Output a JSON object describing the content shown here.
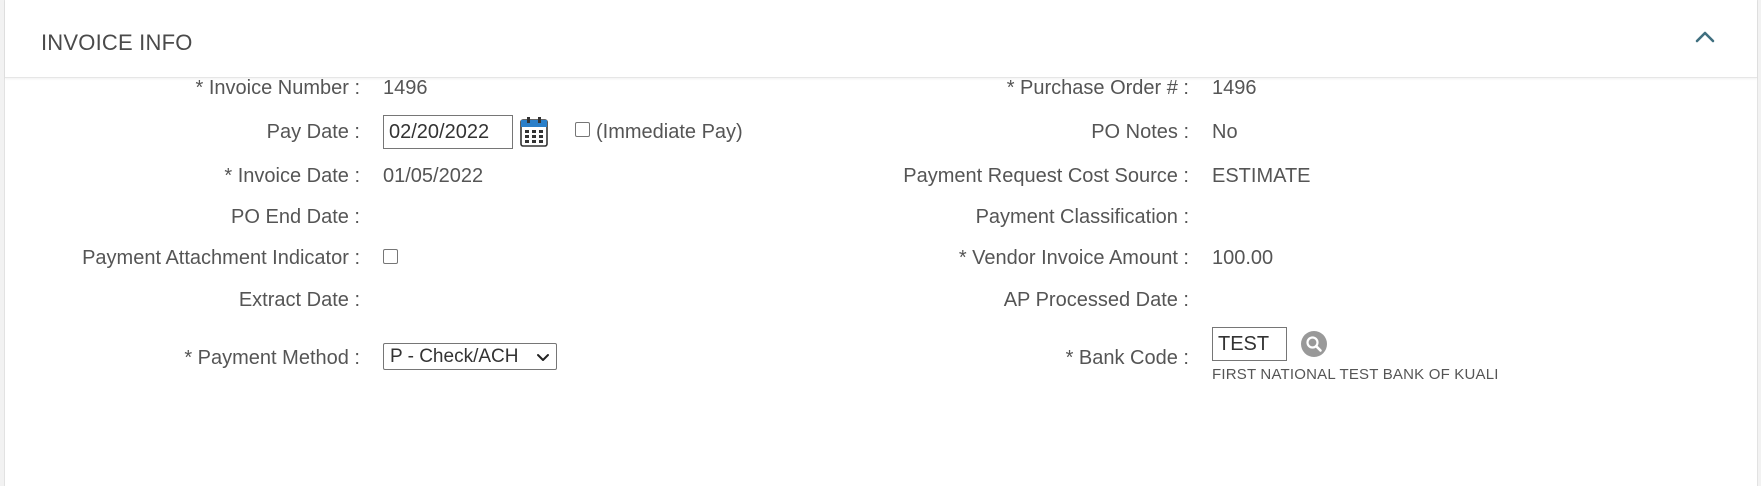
{
  "section": {
    "title": "INVOICE INFO"
  },
  "left": {
    "invoice_number_label": "* Invoice Number :",
    "invoice_number_value": "1496",
    "pay_date_label": "Pay Date :",
    "pay_date_value": "02/20/2022",
    "immediate_pay_label": "(Immediate Pay)",
    "immediate_pay_checked": false,
    "invoice_date_label": "* Invoice Date :",
    "invoice_date_value": "01/05/2022",
    "po_end_date_label": "PO End Date :",
    "po_end_date_value": "",
    "payment_attachment_label": "Payment Attachment Indicator :",
    "payment_attachment_checked": false,
    "extract_date_label": "Extract Date :",
    "extract_date_value": "",
    "payment_method_label": "* Payment Method :",
    "payment_method_value": "P - Check/ACH"
  },
  "right": {
    "purchase_order_label": "* Purchase Order # :",
    "purchase_order_value": "1496",
    "po_notes_label": "PO Notes :",
    "po_notes_value": "No",
    "cost_source_label": "Payment Request Cost Source :",
    "cost_source_value": "ESTIMATE",
    "classification_label": "Payment Classification :",
    "classification_value": "",
    "vendor_amount_label": "* Vendor Invoice Amount :",
    "vendor_amount_value": "100.00",
    "ap_processed_label": "AP Processed Date :",
    "ap_processed_value": "",
    "bank_code_label": "* Bank Code :",
    "bank_code_value": "TEST",
    "bank_name": "FIRST NATIONAL TEST BANK OF KUALI"
  },
  "icons": {
    "collapse": "chevron-up-icon",
    "calendar": "calendar-icon",
    "search": "search-icon",
    "select_arrow": "chevron-down-icon"
  },
  "colors": {
    "text": "#555555",
    "calendar_blue": "#2a7fc9",
    "search_button": "#999999",
    "border": "#767676"
  }
}
